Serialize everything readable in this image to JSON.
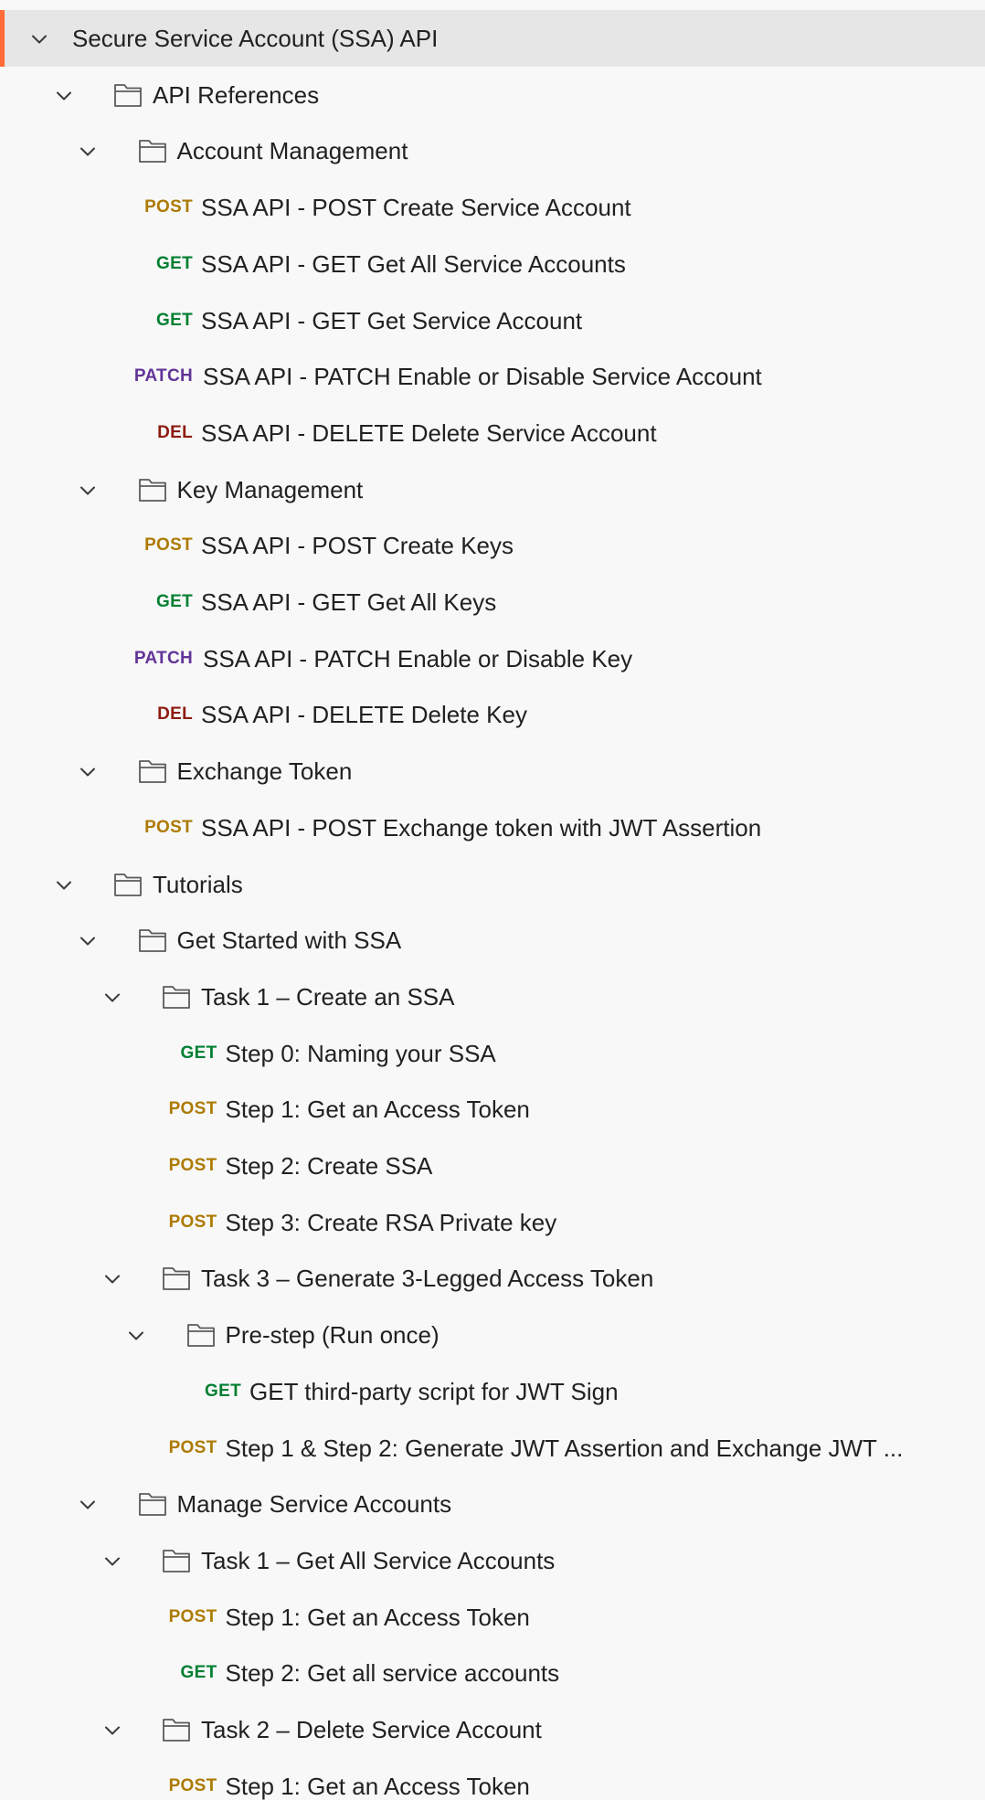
{
  "colors": {
    "selected_accent": "#ff6c37",
    "POST": "#ad7a03",
    "GET": "#007f31",
    "PATCH": "#623497",
    "DEL": "#8e1a10"
  },
  "tree": [
    {
      "type": "collection",
      "depth": 0,
      "label": "Secure Service Account (SSA) API",
      "expanded": true,
      "selected": true,
      "icon": "chevron-down-icon"
    },
    {
      "type": "folder",
      "depth": 1,
      "label": "API References",
      "expanded": true,
      "icon": "folder-icon"
    },
    {
      "type": "folder",
      "depth": 2,
      "label": "Account Management",
      "expanded": true,
      "icon": "folder-icon"
    },
    {
      "type": "request",
      "depth": 3,
      "method": "POST",
      "label": "SSA API - POST Create Service Account"
    },
    {
      "type": "request",
      "depth": 3,
      "method": "GET",
      "label": "SSA API - GET Get All Service Accounts"
    },
    {
      "type": "request",
      "depth": 3,
      "method": "GET",
      "label": "SSA API - GET Get Service Account"
    },
    {
      "type": "request",
      "depth": 3,
      "method": "PATCH",
      "label": "SSA API - PATCH Enable or Disable Service Account"
    },
    {
      "type": "request",
      "depth": 3,
      "method": "DEL",
      "label": "SSA API - DELETE Delete Service Account"
    },
    {
      "type": "folder",
      "depth": 2,
      "label": "Key Management",
      "expanded": true,
      "icon": "folder-icon"
    },
    {
      "type": "request",
      "depth": 3,
      "method": "POST",
      "label": "SSA API - POST Create Keys"
    },
    {
      "type": "request",
      "depth": 3,
      "method": "GET",
      "label": "SSA API - GET Get All Keys"
    },
    {
      "type": "request",
      "depth": 3,
      "method": "PATCH",
      "label": "SSA API - PATCH Enable or Disable Key"
    },
    {
      "type": "request",
      "depth": 3,
      "method": "DEL",
      "label": "SSA API - DELETE Delete Key"
    },
    {
      "type": "folder",
      "depth": 2,
      "label": "Exchange Token",
      "expanded": true,
      "icon": "folder-icon"
    },
    {
      "type": "request",
      "depth": 3,
      "method": "POST",
      "label": "SSA API - POST Exchange token with JWT Assertion"
    },
    {
      "type": "folder",
      "depth": 1,
      "label": "Tutorials",
      "expanded": true,
      "icon": "folder-icon"
    },
    {
      "type": "folder",
      "depth": 2,
      "label": "Get Started with SSA",
      "expanded": true,
      "icon": "folder-icon"
    },
    {
      "type": "folder",
      "depth": 3,
      "label": "Task 1 – Create an SSA",
      "expanded": true,
      "icon": "folder-icon"
    },
    {
      "type": "request",
      "depth": 4,
      "method": "GET",
      "label": "Step 0: Naming your SSA"
    },
    {
      "type": "request",
      "depth": 4,
      "method": "POST",
      "label": "Step 1: Get an Access Token"
    },
    {
      "type": "request",
      "depth": 4,
      "method": "POST",
      "label": "Step 2: Create SSA"
    },
    {
      "type": "request",
      "depth": 4,
      "method": "POST",
      "label": "Step 3: Create RSA Private key"
    },
    {
      "type": "folder",
      "depth": 3,
      "label": "Task 3 – Generate 3-Legged Access Token",
      "expanded": true,
      "icon": "folder-icon"
    },
    {
      "type": "folder",
      "depth": 4,
      "label": "Pre-step (Run once)",
      "expanded": true,
      "icon": "folder-icon"
    },
    {
      "type": "request",
      "depth": 5,
      "method": "GET",
      "label": "GET third-party script for JWT Sign"
    },
    {
      "type": "request",
      "depth": 4,
      "method": "POST",
      "label": "Step 1 & Step 2: Generate JWT Assertion and Exchange JWT ..."
    },
    {
      "type": "folder",
      "depth": 2,
      "label": "Manage Service Accounts",
      "expanded": true,
      "icon": "folder-icon"
    },
    {
      "type": "folder",
      "depth": 3,
      "label": "Task 1 – Get All Service Accounts",
      "expanded": true,
      "icon": "folder-icon"
    },
    {
      "type": "request",
      "depth": 4,
      "method": "POST",
      "label": "Step 1: Get an Access Token"
    },
    {
      "type": "request",
      "depth": 4,
      "method": "GET",
      "label": "Step 2: Get all service accounts"
    },
    {
      "type": "folder",
      "depth": 3,
      "label": "Task 2 – Delete Service Account",
      "expanded": true,
      "icon": "folder-icon"
    },
    {
      "type": "request",
      "depth": 4,
      "method": "POST",
      "label": "Step 1: Get an Access Token"
    }
  ]
}
